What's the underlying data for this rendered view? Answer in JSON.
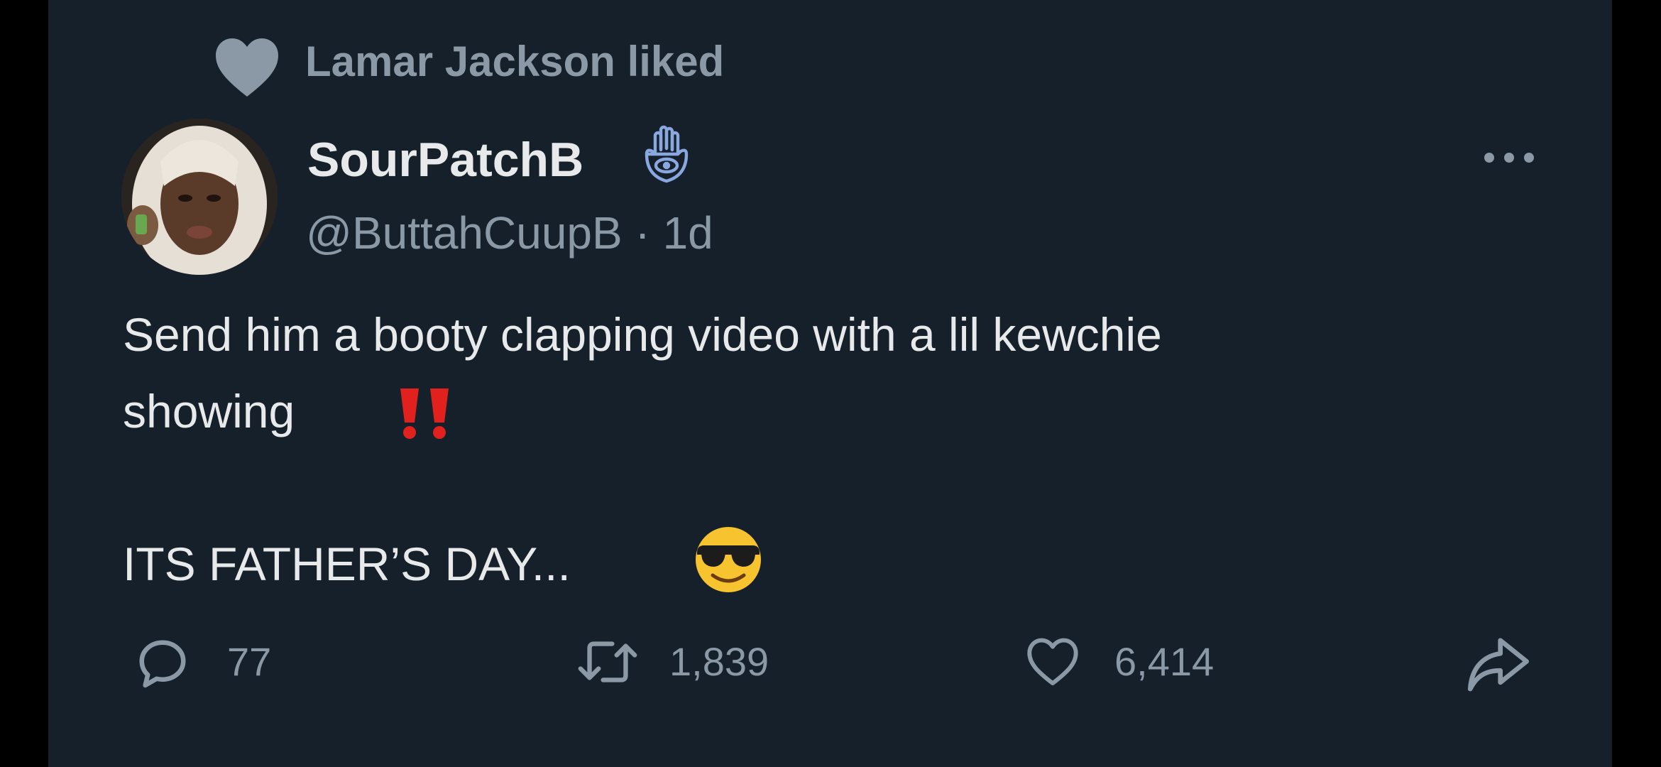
{
  "social_context": "Lamar Jackson liked",
  "author": {
    "display_name": "SourPatchB",
    "handle_line": "@ButtahCuupB · 1d",
    "badge_icon": "hamsa-icon",
    "avatar_icon": "profile-photo"
  },
  "tweet": {
    "line1": "Send him a booty clapping video with a lil kewchie",
    "line2": "showing",
    "line2_emoji": "double-exclamation-icon",
    "line3": "ITS FATHER’S DAY...",
    "line3_emoji": "smiling-face-with-sunglasses-emoji"
  },
  "actions": {
    "reply_count": "77",
    "retweet_count": "1,839",
    "like_count": "6,414"
  },
  "colors": {
    "background": "#15202b",
    "outer": "#000000",
    "text_primary": "#e7e9ea",
    "text_secondary": "#8b98a5",
    "badge": "#8aa8e0",
    "exclaim": "#e0211d"
  }
}
